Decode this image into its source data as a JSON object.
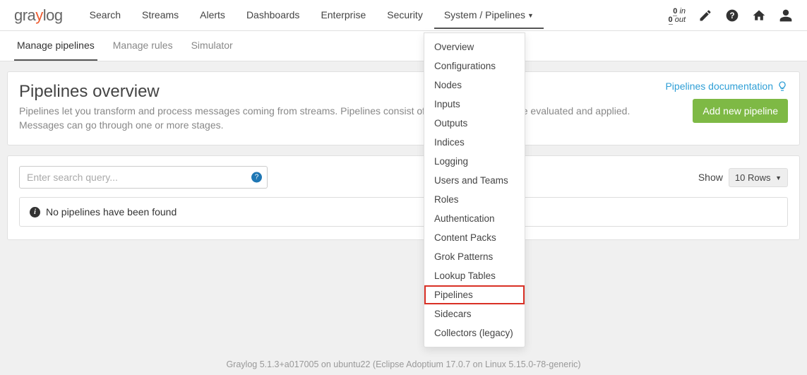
{
  "logo": {
    "part1": "gra",
    "part2": "y",
    "part3": "log"
  },
  "nav": {
    "items": [
      {
        "label": "Search"
      },
      {
        "label": "Streams"
      },
      {
        "label": "Alerts"
      },
      {
        "label": "Dashboards"
      },
      {
        "label": "Enterprise"
      },
      {
        "label": "Security"
      },
      {
        "label": "System / Pipelines",
        "active": true,
        "caret": true
      }
    ]
  },
  "io": {
    "in_n": "0",
    "in_lbl": "in",
    "out_n": "0",
    "out_lbl": "out"
  },
  "subnav": {
    "items": [
      {
        "label": "Manage pipelines",
        "active": true
      },
      {
        "label": "Manage rules"
      },
      {
        "label": "Simulator"
      }
    ]
  },
  "page": {
    "title": "Pipelines overview",
    "desc": "Pipelines let you transform and process messages coming from streams. Pipelines consist of stages where rules are evaluated and applied. Messages can go through one or more stages.",
    "doc_link": "Pipelines documentation",
    "add_btn": "Add new pipeline"
  },
  "search": {
    "placeholder": "Enter search query...",
    "show_label": "Show",
    "rows_label": "10 Rows"
  },
  "empty": {
    "msg": "No pipelines have been found"
  },
  "dropdown": {
    "items": [
      "Overview",
      "Configurations",
      "Nodes",
      "Inputs",
      "Outputs",
      "Indices",
      "Logging",
      "Users and Teams",
      "Roles",
      "Authentication",
      "Content Packs",
      "Grok Patterns",
      "Lookup Tables",
      "Pipelines",
      "Sidecars",
      "Collectors (legacy)"
    ],
    "highlighted": "Pipelines"
  },
  "footer": "Graylog 5.1.3+a017005 on ubuntu22 (Eclipse Adoptium 17.0.7 on Linux 5.15.0-78-generic)"
}
